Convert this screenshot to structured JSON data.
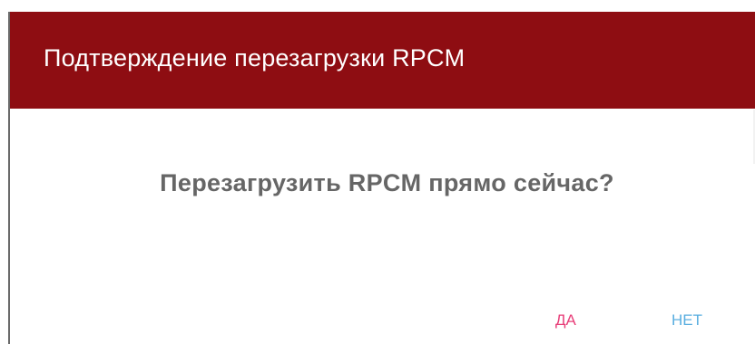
{
  "dialog": {
    "title": "Подтверждение перезагрузки RPCM",
    "message": "Перезагрузить RPCM прямо сейчас?",
    "buttons": {
      "yes_label": "ДА",
      "no_label": "НЕТ"
    }
  },
  "colors": {
    "header_background": "#8e0d12",
    "title_text": "#ffffff",
    "message_text": "#666666",
    "yes_button_text": "#e8407a",
    "no_button_text": "#5aaee0"
  }
}
